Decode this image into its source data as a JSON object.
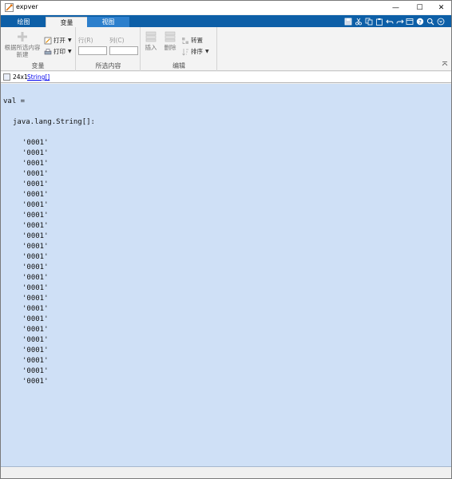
{
  "window": {
    "title": "expver",
    "minimize_glyph": "—",
    "maximize_glyph": "☐",
    "close_glyph": "✕"
  },
  "tabs": [
    {
      "label": "绘图"
    },
    {
      "label": "变量"
    },
    {
      "label": "视图"
    }
  ],
  "ribbon": {
    "variable_group": {
      "label": "变量",
      "new_from_selection_line1": "根据所选内容",
      "new_from_selection_line2": "新建",
      "open_label": "打开",
      "print_label": "打印"
    },
    "selection_group": {
      "label": "所选内容",
      "rows_label": "行(R)",
      "cols_label": "列(C)",
      "rows_value": "",
      "cols_value": ""
    },
    "edit_group": {
      "label": "编辑",
      "insert_label": "插入",
      "delete_label": "删除",
      "transpose_label": "转置",
      "sort_label": "排序"
    }
  },
  "infobar": {
    "size": "24x1",
    "type": "String[]"
  },
  "content": {
    "val_line": "val =",
    "type_line": "java.lang.String[]:",
    "rows": [
      "'0001'",
      "'0001'",
      "'0001'",
      "'0001'",
      "'0001'",
      "'0001'",
      "'0001'",
      "'0001'",
      "'0001'",
      "'0001'",
      "'0001'",
      "'0001'",
      "'0001'",
      "'0001'",
      "'0001'",
      "'0001'",
      "'0001'",
      "'0001'",
      "'0001'",
      "'0001'",
      "'0001'",
      "'0001'",
      "'0001'",
      "'0001'"
    ]
  },
  "colors": {
    "tab_strip": "#0d5fa7",
    "content_bg": "#cfe0f6"
  },
  "icons": [
    "app-icon",
    "save-icon",
    "cut-icon",
    "copy-icon",
    "paste-icon",
    "undo-icon",
    "redo-icon",
    "help-icon",
    "search-icon",
    "expand-icon"
  ]
}
